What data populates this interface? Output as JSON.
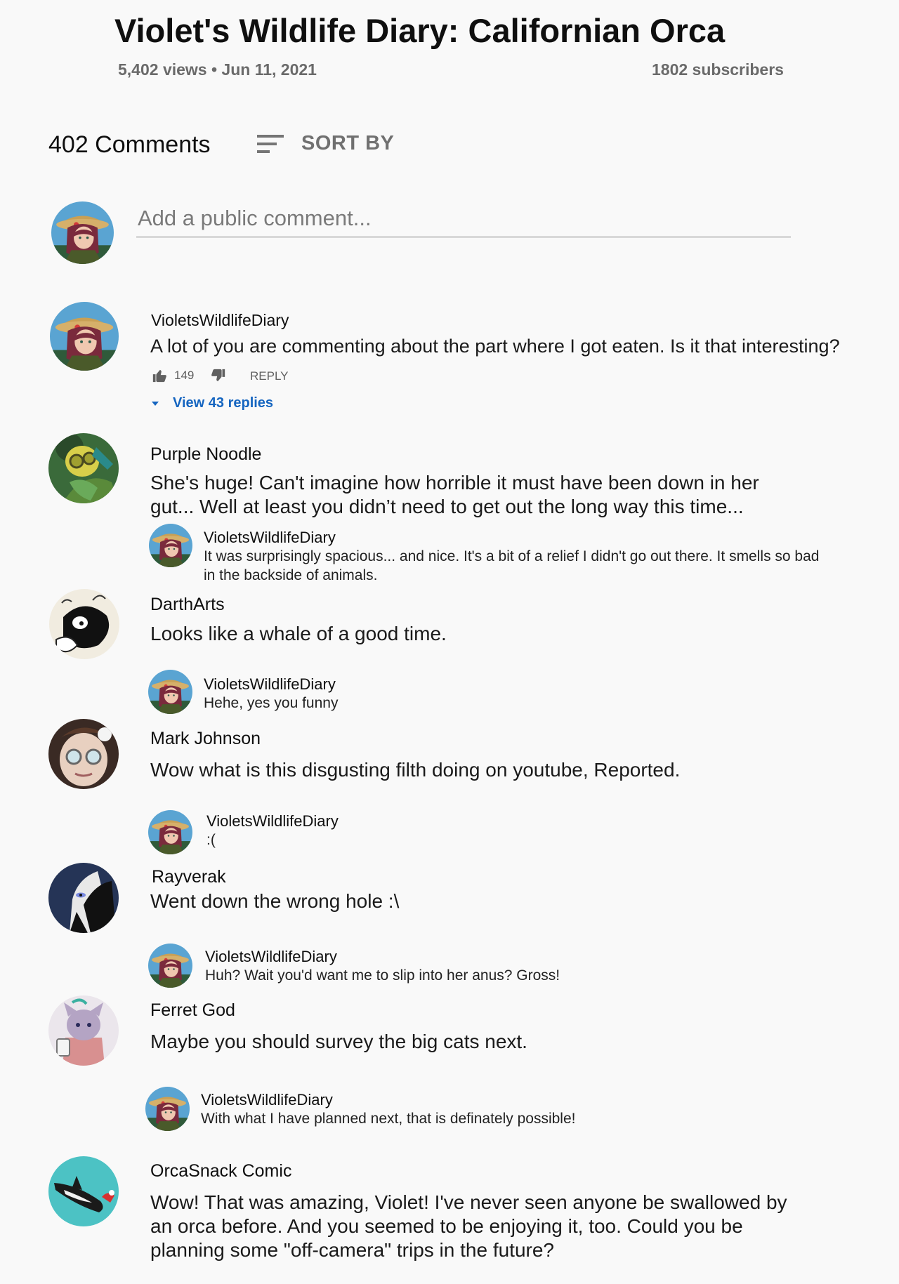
{
  "video": {
    "title": "Violet's Wildlife Diary: Californian Orca",
    "meta": "5,402 views • Jun 11, 2021",
    "subscribers": "1802 subscribers"
  },
  "comments_header": {
    "count_label": "402 Comments",
    "sort_label": "SORT BY"
  },
  "add_comment": {
    "placeholder": "Add a public comment..."
  },
  "pinned": {
    "author": "VioletsWildlifeDiary",
    "text": "A lot of you are commenting about the part where I got eaten. Is it that interesting?",
    "likes": "149",
    "reply_label": "REPLY",
    "view_replies": "View 43 replies"
  },
  "comments": [
    {
      "author": "Purple Noodle",
      "text": "She's huge! Can't imagine how horrible it must have been down in her gut... Well at least you didn’t need to get out the long way this time...",
      "reply": {
        "author": "VioletsWildlifeDiary",
        "text": "It was surprisingly spacious... and nice. It's a bit of a relief I didn't go out there. It smells so bad in the backside of animals."
      }
    },
    {
      "author": "DarthArts",
      "text": "Looks like a whale of a good time.",
      "reply": {
        "author": "VioletsWildlifeDiary",
        "text": "Hehe, yes you funny"
      }
    },
    {
      "author": "Mark Johnson",
      "text": "Wow what is this disgusting filth doing on youtube, Reported.",
      "reply": {
        "author": "VioletsWildlifeDiary",
        "text": ":("
      }
    },
    {
      "author": "Rayverak",
      "text": "Went down the wrong hole :\\",
      "reply": {
        "author": "VioletsWildlifeDiary",
        "text": "Huh? Wait you'd want me to slip into her anus? Gross!"
      }
    },
    {
      "author": "Ferret God",
      "text": "Maybe you should survey the big cats next.",
      "reply": {
        "author": "VioletsWildlifeDiary",
        "text": "With what I have planned next, that is definately possible!"
      }
    },
    {
      "author": "OrcaSnack Comic",
      "text": "Wow! That was amazing, Violet! I've never seen anyone be swallowed by an orca before. And you seemed to be enjoying it, too. Could you be planning some \"off-camera\" trips in the future?"
    }
  ],
  "icons": [
    "sort-icon",
    "thumbs-up-icon",
    "thumbs-down-icon",
    "caret-down-icon"
  ],
  "colors": {
    "link_blue": "#1565c0",
    "background": "#f9f9f9",
    "muted_text": "#6a6a6a"
  }
}
